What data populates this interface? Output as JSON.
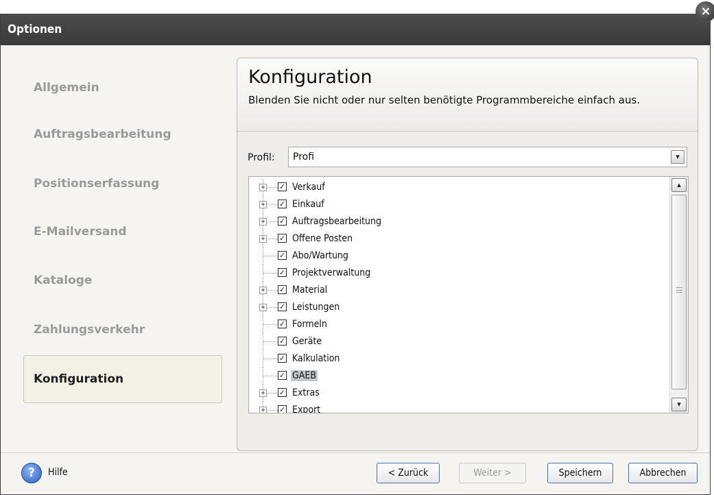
{
  "window": {
    "title": "Optionen",
    "close_symbol": "×"
  },
  "sidebar": {
    "items": [
      {
        "label": "Allgemein"
      },
      {
        "label": "Auftragsbearbeitung"
      },
      {
        "label": "Positionserfassung"
      },
      {
        "label": "E-Mailversand"
      },
      {
        "label": "Kataloge"
      },
      {
        "label": "Zahlungsverkehr"
      },
      {
        "label": "Konfiguration",
        "active": true
      }
    ]
  },
  "panel": {
    "title": "Konfiguration",
    "description": "Blenden Sie nicht oder nur selten benötigte Programmbereiche einfach aus.",
    "profil_label": "Profil:",
    "profil_value": "Profi",
    "dropdown_symbol": "▾"
  },
  "tree": {
    "items": [
      {
        "label": "Verkauf",
        "expandable": true,
        "checked": true
      },
      {
        "label": "Einkauf",
        "expandable": true,
        "checked": true
      },
      {
        "label": "Auftragsbearbeitung",
        "expandable": true,
        "checked": true
      },
      {
        "label": "Offene Posten",
        "expandable": true,
        "checked": true
      },
      {
        "label": "Abo/Wartung",
        "expandable": false,
        "checked": true
      },
      {
        "label": "Projektverwaltung",
        "expandable": false,
        "checked": true
      },
      {
        "label": "Material",
        "expandable": true,
        "checked": true
      },
      {
        "label": "Leistungen",
        "expandable": true,
        "checked": true
      },
      {
        "label": "Formeln",
        "expandable": false,
        "checked": true
      },
      {
        "label": "Geräte",
        "expandable": false,
        "checked": true
      },
      {
        "label": "Kalkulation",
        "expandable": false,
        "checked": true
      },
      {
        "label": "GAEB",
        "expandable": false,
        "checked": true,
        "selected": true
      },
      {
        "label": "Extras",
        "expandable": true,
        "checked": true
      },
      {
        "label": "Export",
        "expandable": true,
        "checked": true
      }
    ],
    "expander_symbol": "+",
    "check_symbol": "✓",
    "scroll_up": "▴",
    "scroll_down": "▾"
  },
  "footer": {
    "help_symbol": "?",
    "help_label": "Hilfe",
    "back_label": "< Zurück",
    "next_label": "Weiter >",
    "save_label": "Speichern",
    "cancel_label": "Abbrechen"
  },
  "colors": {
    "titlebar": "#3f3f3f",
    "background": "#f5f4f0",
    "selected_row": "#c5c8d1",
    "button_border": "#4d6fa8"
  }
}
